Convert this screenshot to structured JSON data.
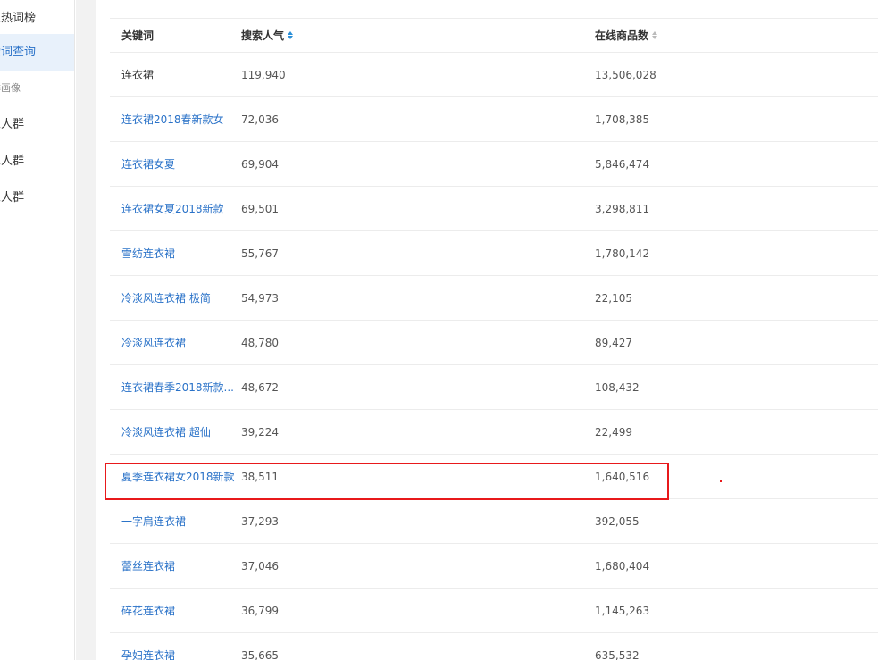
{
  "sidebar": {
    "items": [
      {
        "label": "业热词榜",
        "active": false
      },
      {
        "label": "索词查询",
        "active": true
      },
      {
        "label": "群画像",
        "sub": true
      },
      {
        "label": "家人群",
        "active": false
      },
      {
        "label": "家人群",
        "active": false
      },
      {
        "label": "家人群",
        "active": false
      }
    ]
  },
  "table": {
    "headers": {
      "keyword": "关键词",
      "popularity": "搜索人气",
      "products": "在线商品数"
    },
    "rows": [
      {
        "keyword": "连衣裙",
        "popularity": "119,940",
        "products": "13,506,028"
      },
      {
        "keyword": "连衣裙2018春新款女",
        "popularity": "72,036",
        "products": "1,708,385"
      },
      {
        "keyword": "连衣裙女夏",
        "popularity": "69,904",
        "products": "5,846,474"
      },
      {
        "keyword": "连衣裙女夏2018新款",
        "popularity": "69,501",
        "products": "3,298,811"
      },
      {
        "keyword": "雪纺连衣裙",
        "popularity": "55,767",
        "products": "1,780,142"
      },
      {
        "keyword": "冷淡风连衣裙 极简",
        "popularity": "54,973",
        "products": "22,105"
      },
      {
        "keyword": "冷淡风连衣裙",
        "popularity": "48,780",
        "products": "89,427"
      },
      {
        "keyword": "连衣裙春季2018新款...",
        "popularity": "48,672",
        "products": "108,432"
      },
      {
        "keyword": "冷淡风连衣裙 超仙",
        "popularity": "39,224",
        "products": "22,499"
      },
      {
        "keyword": "夏季连衣裙女2018新款",
        "popularity": "38,511",
        "products": "1,640,516"
      },
      {
        "keyword": "一字肩连衣裙",
        "popularity": "37,293",
        "products": "392,055"
      },
      {
        "keyword": "蕾丝连衣裙",
        "popularity": "37,046",
        "products": "1,680,404"
      },
      {
        "keyword": "碎花连衣裙",
        "popularity": "36,799",
        "products": "1,145,263"
      },
      {
        "keyword": "孕妇连衣裙",
        "popularity": "35,665",
        "products": "635,532"
      }
    ]
  },
  "colors": {
    "accent": "#2a72c8",
    "highlight": "#e8191b"
  }
}
